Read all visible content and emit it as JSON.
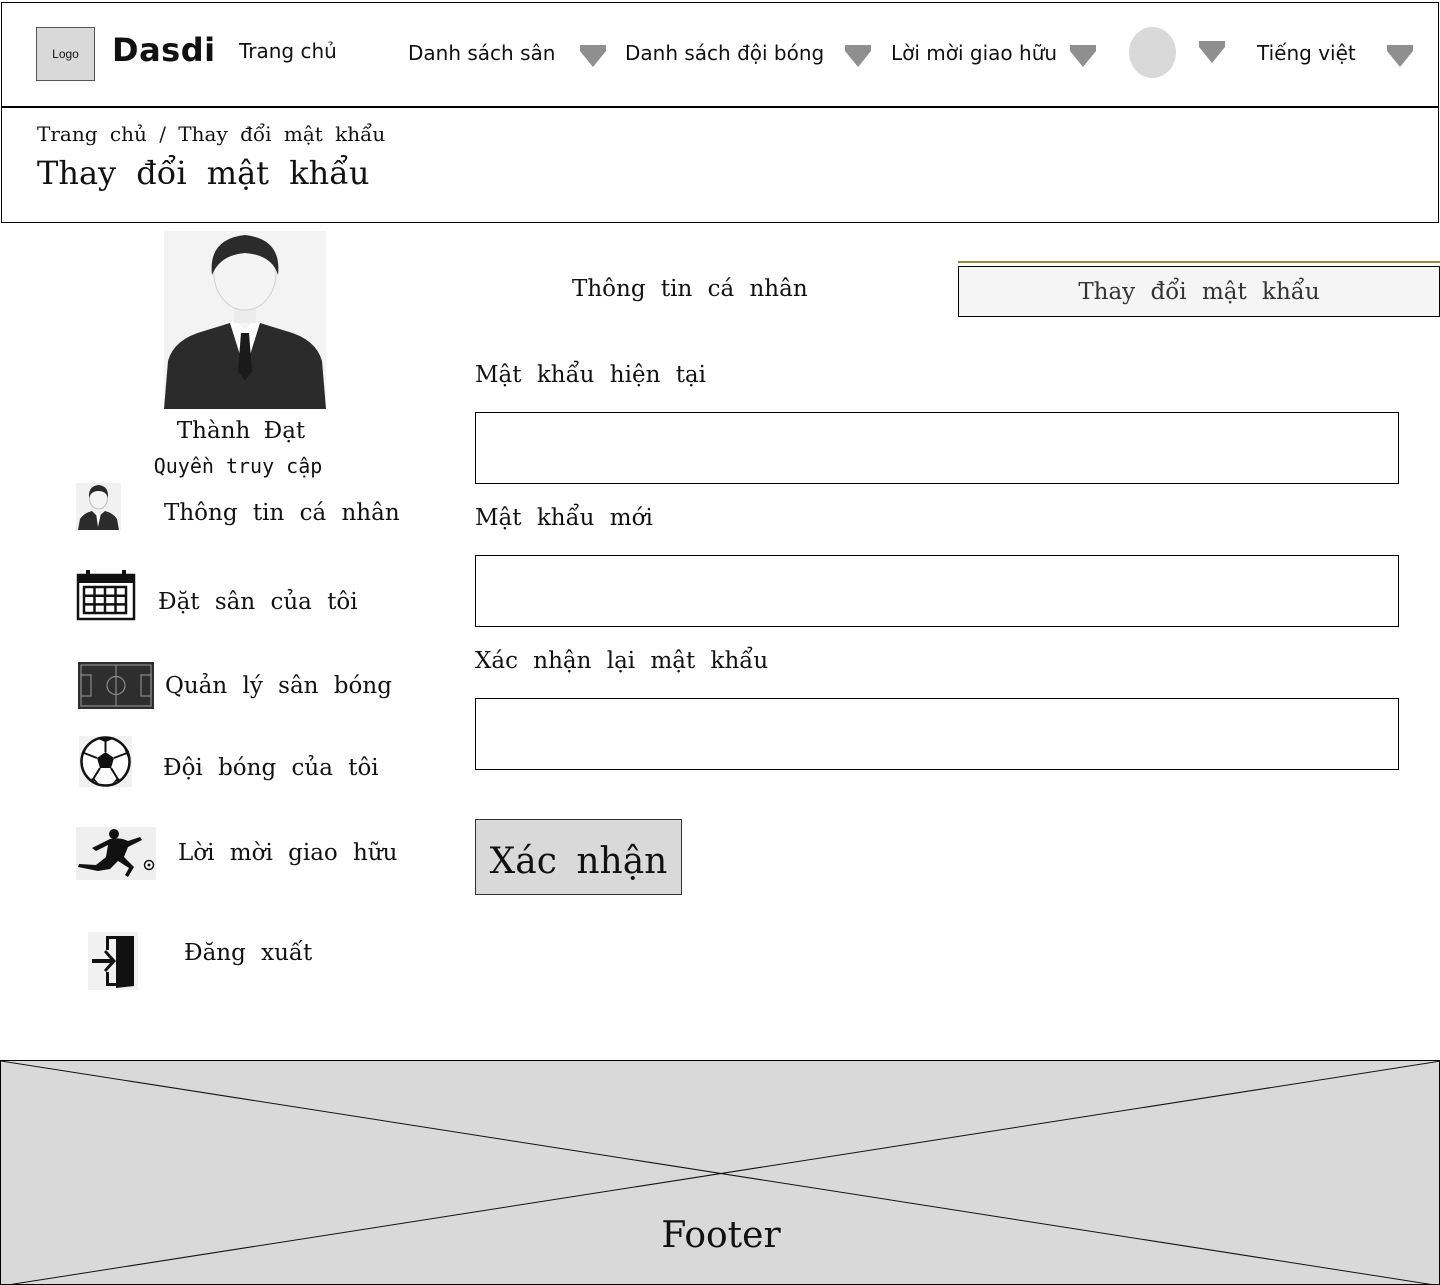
{
  "header": {
    "logo_text": "Logo",
    "brand": "Dasdi",
    "nav": {
      "home": "Trang chủ",
      "fields": "Danh sách sân",
      "teams": "Danh sách đội bóng",
      "invites": "Lời mời giao hữu",
      "language": "Tiếng việt"
    }
  },
  "breadcrumb": {
    "home": "Trang chủ",
    "separator": "/",
    "current": "Thay đổi mật khẩu"
  },
  "page_title": "Thay đổi mật khẩu",
  "profile": {
    "name": "Thành Đạt",
    "role": "Quyền truy cập"
  },
  "sidebar": {
    "items": [
      {
        "label": "Thông tin cá nhân",
        "icon": "person-icon"
      },
      {
        "label": "Đặt sân của tôi",
        "icon": "calendar-icon"
      },
      {
        "label": "Quản lý sân bóng",
        "icon": "football-field-icon"
      },
      {
        "label": "Đội bóng của tôi",
        "icon": "soccer-ball-icon"
      },
      {
        "label": "Lời mời giao hữu",
        "icon": "soccer-player-icon"
      },
      {
        "label": "Đăng xuất",
        "icon": "logout-icon"
      }
    ]
  },
  "tabs": {
    "info": "Thông tin cá nhân",
    "change_password": "Thay đổi mật khẩu"
  },
  "form": {
    "current_password_label": "Mật khẩu hiện tại",
    "current_password_value": "",
    "new_password_label": "Mật khẩu mới",
    "new_password_value": "",
    "confirm_password_label": "Xác nhận lại mật khẩu",
    "confirm_password_value": "",
    "submit_label": "Xác nhận"
  },
  "footer": {
    "label": "Footer"
  },
  "colors": {
    "placeholder_gray": "#d9d9d9",
    "caret_gray": "#8f8f8f",
    "tab_rule": "#9d8a3a"
  }
}
